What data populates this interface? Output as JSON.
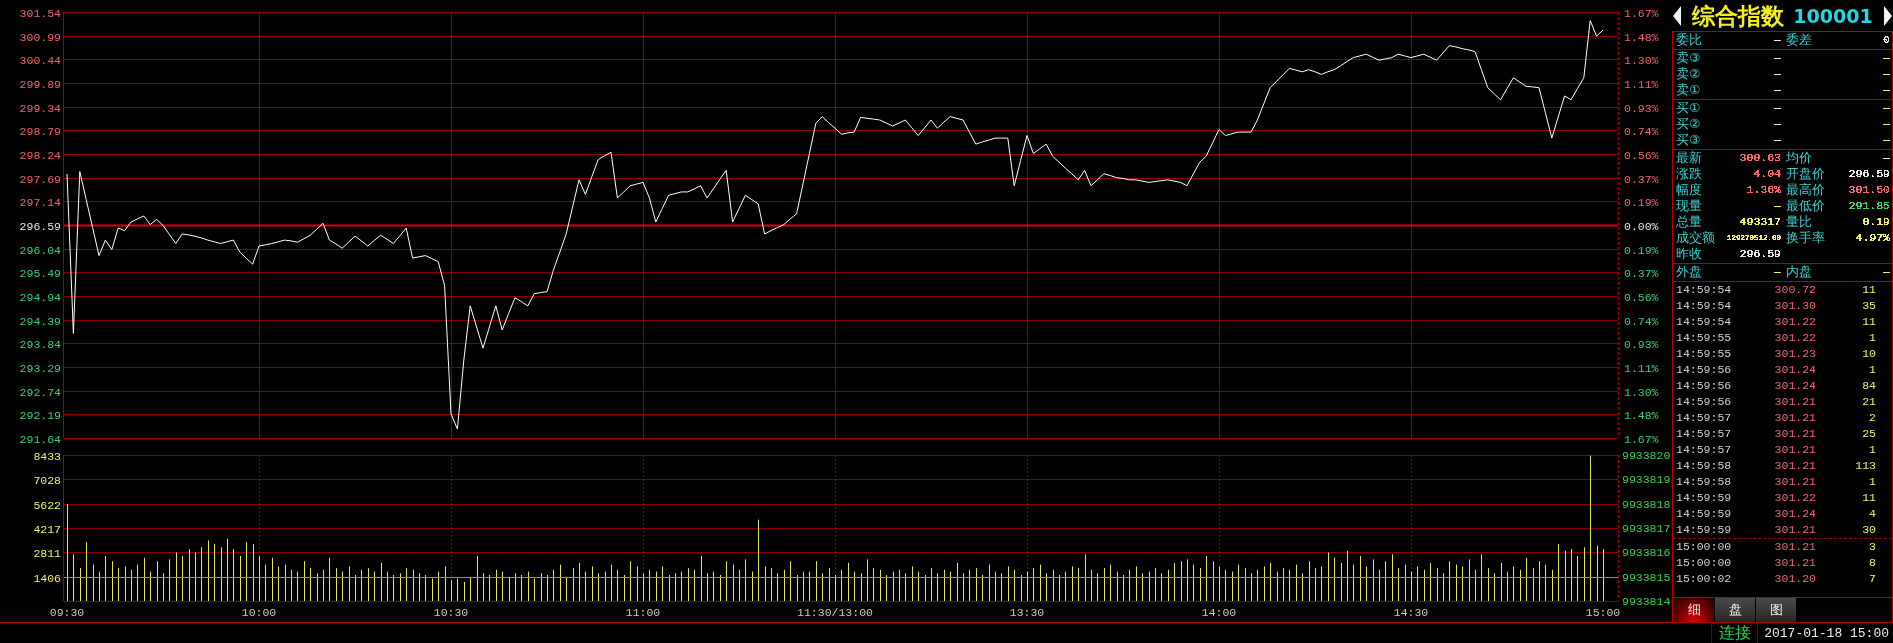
{
  "price_chart": {
    "chart_data": {
      "type": "line",
      "categories": [
        null,
        null,
        null,
        null,
        null,
        null,
        null,
        null,
        null,
        null,
        null,
        null,
        null,
        null,
        null,
        null,
        null,
        null,
        null,
        null,
        null,
        null,
        null,
        null,
        null,
        null,
        null,
        null,
        null,
        null,
        null,
        null,
        null,
        null,
        null,
        null,
        null,
        null,
        null,
        null,
        null,
        null,
        null,
        null,
        null,
        null,
        null,
        null,
        null,
        null,
        null,
        null,
        null,
        null,
        null,
        null,
        null,
        null,
        null,
        null,
        null,
        null,
        null,
        null,
        null,
        null,
        null,
        null,
        null,
        null,
        null,
        null,
        null,
        null,
        null,
        null,
        null,
        null,
        null,
        null,
        null,
        null,
        null,
        null,
        null,
        null,
        null,
        null,
        null,
        null,
        null,
        null,
        null,
        null,
        null,
        null,
        null,
        null,
        null,
        null,
        null,
        null,
        null,
        null,
        null,
        null,
        null,
        null,
        null,
        null,
        null,
        null,
        null,
        null,
        null,
        null,
        null,
        null,
        null,
        null,
        null,
        null,
        null,
        null,
        null,
        null,
        null,
        null,
        null,
        null,
        null,
        null,
        null,
        null,
        null,
        null,
        null,
        null,
        null,
        null,
        null,
        null,
        null,
        null,
        null,
        null,
        null,
        null,
        null,
        null,
        null,
        null,
        null,
        null,
        null,
        null,
        null,
        null,
        null,
        null,
        null,
        null,
        null,
        null,
        null,
        null,
        null,
        null,
        null,
        null,
        null,
        null,
        null,
        null,
        null,
        null,
        null,
        null,
        null,
        null,
        null,
        null,
        null,
        null,
        null,
        null,
        null,
        null,
        null,
        null,
        null,
        null,
        null,
        null,
        null,
        null,
        null,
        null,
        null,
        null,
        null,
        null,
        null,
        null,
        null,
        null,
        null,
        null,
        null,
        null,
        null,
        null,
        null,
        null,
        null,
        null,
        null,
        null,
        null,
        null,
        null,
        null,
        null,
        null,
        null,
        null,
        null,
        null,
        null,
        null,
        null,
        null,
        null,
        null,
        null,
        null,
        null,
        null,
        null,
        null,
        null
      ],
      "series": [
        {
          "color": "#ffffff",
          "values": [
            297.78,
            294.07,
            297.83,
            297.18,
            296.53,
            295.88,
            296.24,
            296.02,
            296.52,
            296.46,
            296.66,
            296.73,
            296.8,
            296.6,
            296.72,
            296.58,
            296.37,
            296.16,
            296.38,
            296.36,
            296.33,
            296.29,
            296.24,
            296.2,
            296.16,
            296.2,
            296.24,
            295.96,
            295.82,
            295.68,
            296.1,
            296.13,
            296.16,
            296.2,
            296.24,
            296.22,
            296.19,
            296.27,
            296.35,
            296.49,
            296.63,
            296.24,
            296.15,
            296.05,
            296.19,
            296.33,
            296.22,
            296.1,
            296.23,
            296.35,
            296.26,
            296.16,
            296.34,
            296.52,
            295.82,
            295.85,
            295.88,
            295.81,
            295.74,
            295.18,
            292.2,
            291.85,
            293.45,
            294.71,
            294.22,
            293.73,
            294.22,
            294.71,
            294.15,
            294.53,
            294.9,
            294.81,
            294.71,
            294.99,
            295.02,
            295.04,
            295.54,
            295.96,
            296.38,
            297.01,
            297.64,
            297.3,
            297.71,
            298.11,
            298.2,
            298.28,
            297.22,
            297.36,
            297.5,
            297.54,
            297.58,
            297.22,
            296.66,
            296.97,
            297.28,
            297.32,
            297.36,
            297.36,
            297.43,
            297.5,
            297.22,
            297.43,
            297.65,
            297.86,
            296.66,
            296.97,
            297.28,
            297.18,
            297.08,
            296.38,
            296.46,
            296.53,
            296.6,
            296.73,
            296.85,
            297.55,
            298.25,
            298.95,
            299.11,
            298.97,
            298.84,
            298.7,
            298.73,
            298.75,
            299.09,
            299.07,
            299.05,
            299.03,
            298.96,
            298.89,
            298.96,
            299.03,
            298.85,
            298.67,
            298.85,
            299.03,
            298.84,
            298.98,
            299.11,
            299.07,
            299.03,
            298.75,
            298.47,
            298.52,
            298.56,
            298.61,
            298.61,
            298.61,
            297.5,
            298.09,
            298.67,
            298.25,
            298.36,
            298.47,
            298.19,
            298.05,
            297.91,
            297.78,
            297.64,
            297.86,
            297.5,
            297.64,
            297.78,
            297.74,
            297.69,
            297.67,
            297.64,
            297.64,
            297.61,
            297.58,
            297.6,
            297.62,
            297.64,
            297.61,
            297.58,
            297.5,
            297.78,
            298.05,
            298.19,
            298.5,
            298.81,
            298.67,
            298.71,
            298.75,
            298.75,
            298.75,
            299.03,
            299.41,
            299.78,
            299.93,
            300.08,
            300.23,
            300.19,
            300.15,
            300.2,
            300.15,
            300.09,
            300.15,
            300.2,
            300.29,
            300.39,
            300.48,
            300.52,
            300.56,
            300.49,
            300.42,
            300.45,
            300.48,
            300.56,
            300.52,
            300.48,
            300.52,
            300.56,
            300.49,
            300.42,
            300.59,
            300.76,
            300.73,
            300.69,
            300.66,
            300.62,
            300.2,
            299.78,
            299.64,
            299.5,
            299.76,
            300.01,
            299.91,
            299.81,
            299.8,
            299.78,
            299.2,
            298.61,
            299.1,
            299.59,
            299.5,
            299.76,
            300.01,
            301.34,
            300.98,
            301.12
          ]
        }
      ],
      "ylim": [
        291.64,
        301.54
      ],
      "yticks": [
        301.54,
        300.99,
        300.44,
        299.89,
        299.34,
        298.79,
        298.24,
        297.69,
        297.14,
        296.59,
        296.04,
        295.49,
        294.94,
        294.39,
        293.84,
        293.29,
        292.74,
        292.19,
        291.64
      ],
      "grid": true,
      "ref_lines": [
        {
          "axis": "y",
          "value": 296.59,
          "color": "#e00000"
        }
      ]
    },
    "right_axis_labels": [
      "1.67%",
      "1.48%",
      "1.30%",
      "1.11%",
      "0.93%",
      "0.74%",
      "0.56%",
      "0.37%",
      "0.19%",
      "0.00%",
      "0.19%",
      "0.37%",
      "0.56%",
      "0.74%",
      "0.93%",
      "1.11%",
      "1.30%",
      "1.48%",
      "1.67%"
    ]
  },
  "volume_chart": {
    "chart_data": {
      "type": "bar",
      "categories": [
        "09:30",
        null,
        null,
        null,
        null,
        null,
        null,
        null,
        null,
        null,
        null,
        null,
        null,
        null,
        null,
        null,
        null,
        null,
        null,
        null,
        null,
        null,
        null,
        null,
        null,
        null,
        null,
        null,
        null,
        null,
        "10:00",
        null,
        null,
        null,
        null,
        null,
        null,
        null,
        null,
        null,
        null,
        null,
        null,
        null,
        null,
        null,
        null,
        null,
        null,
        null,
        null,
        null,
        null,
        null,
        null,
        null,
        null,
        null,
        null,
        null,
        "10:30",
        null,
        null,
        null,
        null,
        null,
        null,
        null,
        null,
        null,
        null,
        null,
        null,
        null,
        null,
        null,
        null,
        null,
        null,
        null,
        null,
        null,
        null,
        null,
        null,
        null,
        null,
        null,
        null,
        null,
        "11:00",
        null,
        null,
        null,
        null,
        null,
        null,
        null,
        null,
        null,
        null,
        null,
        null,
        null,
        null,
        null,
        null,
        null,
        null,
        null,
        null,
        null,
        null,
        null,
        null,
        null,
        null,
        null,
        null,
        null,
        "11:30/13:00",
        null,
        null,
        null,
        null,
        null,
        null,
        null,
        null,
        null,
        null,
        null,
        null,
        null,
        null,
        null,
        null,
        null,
        null,
        null,
        null,
        null,
        null,
        null,
        null,
        null,
        null,
        null,
        null,
        null,
        "13:30",
        null,
        null,
        null,
        null,
        null,
        null,
        null,
        null,
        null,
        null,
        null,
        null,
        null,
        null,
        null,
        null,
        null,
        null,
        null,
        null,
        null,
        null,
        null,
        null,
        null,
        null,
        null,
        null,
        null,
        "14:00",
        null,
        null,
        null,
        null,
        null,
        null,
        null,
        null,
        null,
        null,
        null,
        null,
        null,
        null,
        null,
        null,
        null,
        null,
        null,
        null,
        null,
        null,
        null,
        null,
        null,
        null,
        null,
        null,
        null,
        "14:30",
        null,
        null,
        null,
        null,
        null,
        null,
        null,
        null,
        null,
        null,
        null,
        null,
        null,
        null,
        null,
        null,
        null,
        null,
        null,
        null,
        null,
        null,
        null,
        null,
        null,
        null,
        null,
        null,
        null,
        "15:00"
      ],
      "series": [
        {
          "color": "#e6e65a",
          "values": [
            5600,
            2700,
            1900,
            3400,
            2100,
            1700,
            2600,
            2300,
            1900,
            2000,
            1800,
            2100,
            2500,
            1700,
            2300,
            1600,
            2400,
            2800,
            2600,
            3000,
            2800,
            3100,
            3500,
            3300,
            3100,
            3600,
            3000,
            2600,
            3400,
            3300,
            2600,
            2100,
            2500,
            2000,
            2100,
            1800,
            1700,
            2300,
            1900,
            1600,
            1800,
            2500,
            1900,
            1700,
            2000,
            1500,
            1800,
            1900,
            1700,
            2200,
            1700,
            1500,
            1600,
            1900,
            1800,
            1600,
            1500,
            1300,
            1700,
            2000,
            1200,
            1300,
            1100,
            1400,
            2600,
            1600,
            1500,
            1800,
            1700,
            1400,
            1600,
            1500,
            1700,
            1300,
            1600,
            1500,
            1800,
            2100,
            1400,
            1900,
            2200,
            1700,
            2000,
            1600,
            1700,
            2100,
            1800,
            1500,
            2300,
            2000,
            1600,
            1800,
            1700,
            2000,
            1500,
            1600,
            1700,
            1900,
            1800,
            2600,
            1600,
            1700,
            1500,
            2300,
            2100,
            1800,
            2400,
            1700,
            4700,
            2000,
            1900,
            1600,
            1800,
            2300,
            1500,
            1700,
            1700,
            2300,
            1600,
            1900,
            1500,
            1800,
            2200,
            1700,
            1600,
            2400,
            1900,
            1800,
            1500,
            1700,
            1800,
            1600,
            2000,
            1700,
            1500,
            1900,
            1600,
            1800,
            1700,
            2200,
            1600,
            1800,
            1900,
            1500,
            2100,
            1700,
            1600,
            2000,
            1800,
            1500,
            1700,
            1900,
            2100,
            1600,
            1800,
            1500,
            1700,
            2000,
            1900,
            2700,
            1800,
            1600,
            1900,
            2100,
            1700,
            1500,
            1800,
            2000,
            1600,
            1700,
            1900,
            1600,
            1800,
            2200,
            2300,
            2400,
            2100,
            1900,
            2600,
            2300,
            2000,
            1800,
            1700,
            2100,
            1900,
            1600,
            1800,
            2000,
            2200,
            1700,
            1900,
            1800,
            2100,
            1600,
            2300,
            1900,
            2000,
            2800,
            2500,
            2200,
            2900,
            2100,
            2600,
            2000,
            2400,
            1800,
            2300,
            2700,
            1900,
            2100,
            1700,
            2000,
            1800,
            2200,
            1900,
            1600,
            2300,
            2100,
            2000,
            2400,
            1800,
            2700,
            1900,
            1600,
            2200,
            1700,
            2000,
            1800,
            2500,
            1900,
            2300,
            2100,
            1800,
            3300,
            2900,
            3000,
            2600,
            3100,
            8400,
            3200,
            3000
          ]
        }
      ],
      "ylim": [
        0,
        8433
      ],
      "yticks": [
        8433,
        7028,
        5622,
        4217,
        2811,
        1406
      ],
      "grid": true,
      "ref_lines": [
        {
          "axis": "y",
          "value": 1406,
          "color": "#30d030"
        }
      ]
    },
    "right_axis_labels": [
      "9933820",
      "9933819",
      "9933818",
      "9933817",
      "9933816",
      "9933815",
      "9933814"
    ]
  },
  "quote_panel": {
    "title": {
      "name": "综合指数",
      "code": "100001"
    },
    "sections": [
      {
        "rows": [
          {
            "label": "委比",
            "value": {
              "text": "—",
              "color": "#e8e8e8"
            },
            "label_2": "委差",
            "value_2": {
              "text": "0",
              "color": "#e8e8e8"
            }
          }
        ]
      },
      {
        "rows": [
          {
            "label": "卖③",
            "value": {
              "text": "—",
              "color": "#e8e8e8"
            },
            "value_2": {
              "text": "—",
              "color": "#f0f064"
            }
          },
          {
            "label": "卖②",
            "value": {
              "text": "—",
              "color": "#e8e8e8"
            },
            "value_2": {
              "text": "—",
              "color": "#f0f064"
            }
          },
          {
            "label": "卖①",
            "value": {
              "text": "—",
              "color": "#e8e8e8"
            },
            "value_2": {
              "text": "—",
              "color": "#f0f064"
            }
          }
        ]
      },
      {
        "rows": [
          {
            "label": "买①",
            "value": {
              "text": "—",
              "color": "#e8e8e8"
            },
            "value_2": {
              "text": "—",
              "color": "#f0f064"
            }
          },
          {
            "label": "买②",
            "value": {
              "text": "—",
              "color": "#e8e8e8"
            },
            "value_2": {
              "text": "—",
              "color": "#f0f064"
            }
          },
          {
            "label": "买③",
            "value": {
              "text": "—",
              "color": "#e8e8e8"
            },
            "value_2": {
              "text": "—",
              "color": "#f0f064"
            }
          }
        ]
      },
      {
        "rows": [
          {
            "label": "最新",
            "value": {
              "text": "300.63",
              "color": "#f06868"
            },
            "label_2": "均价",
            "value_2": {
              "text": "—",
              "color": "#e8e8e8"
            }
          },
          {
            "label": "涨跌",
            "value": {
              "text": "4.04",
              "color": "#f06868"
            },
            "label_2": "开盘价",
            "value_2": {
              "text": "296.59",
              "color": "#e8e8e8"
            }
          },
          {
            "label": "幅度",
            "value": {
              "text": "1.36%",
              "color": "#f06868"
            },
            "label_2": "最高价",
            "value_2": {
              "text": "301.50",
              "color": "#f06868"
            }
          },
          {
            "label": "现量",
            "value": {
              "text": "—",
              "color": "#f0f064"
            },
            "label_2": "最低价",
            "value_2": {
              "text": "291.85",
              "color": "#40d066"
            }
          },
          {
            "label": "总量",
            "value": {
              "text": "493317",
              "color": "#f0f064"
            },
            "label_2": "量比",
            "value_2": {
              "text": "0.19",
              "color": "#f0f064"
            }
          },
          {
            "label": "成交额",
            "value": {
              "text": "129270512.00",
              "color": "#f0f064"
            },
            "label_2": "换手率",
            "value_2": {
              "text": "4.97%",
              "color": "#f0f064"
            }
          },
          {
            "label": "昨收",
            "value": {
              "text": "296.59",
              "color": "#e8e8e8"
            }
          }
        ]
      },
      {
        "rows": [
          {
            "label": "外盘",
            "value": {
              "text": "—",
              "color": "#f0f064"
            },
            "label_2": "内盘",
            "value_2": {
              "text": "—",
              "color": "#f0f064"
            }
          }
        ]
      }
    ],
    "trade_groups": [
      {
        "trades": [
          {
            "time": "14:59:54",
            "price": "300.72",
            "volume": "11"
          },
          {
            "time": "14:59:54",
            "price": "301.30",
            "volume": "35"
          },
          {
            "time": "14:59:54",
            "price": "301.22",
            "volume": "11"
          },
          {
            "time": "14:59:55",
            "price": "301.22",
            "volume": "1"
          },
          {
            "time": "14:59:55",
            "price": "301.23",
            "volume": "10"
          },
          {
            "time": "14:59:56",
            "price": "301.24",
            "volume": "1"
          },
          {
            "time": "14:59:56",
            "price": "301.24",
            "volume": "84"
          },
          {
            "time": "14:59:56",
            "price": "301.21",
            "volume": "21"
          },
          {
            "time": "14:59:57",
            "price": "301.21",
            "volume": "2"
          },
          {
            "time": "14:59:57",
            "price": "301.21",
            "volume": "25"
          },
          {
            "time": "14:59:57",
            "price": "301.21",
            "volume": "1"
          },
          {
            "time": "14:59:58",
            "price": "301.21",
            "volume": "113"
          },
          {
            "time": "14:59:58",
            "price": "301.21",
            "volume": "1"
          },
          {
            "time": "14:59:59",
            "price": "301.22",
            "volume": "11"
          },
          {
            "time": "14:59:59",
            "price": "301.24",
            "volume": "4"
          },
          {
            "time": "14:59:59",
            "price": "301.21",
            "volume": "30"
          }
        ]
      },
      {
        "trades": [
          {
            "time": "15:00:00",
            "price": "301.21",
            "volume": "3"
          },
          {
            "time": "15:00:00",
            "price": "301.21",
            "volume": "8"
          },
          {
            "time": "15:00:02",
            "price": "301.20",
            "volume": "7"
          }
        ]
      }
    ],
    "tabs": [
      {
        "label": "细",
        "selected": true
      },
      {
        "label": "盘",
        "selected": false
      },
      {
        "label": "图",
        "selected": false
      }
    ]
  },
  "status_bar": {
    "connection": "连接",
    "datetime": "2017-01-18 15:00"
  }
}
